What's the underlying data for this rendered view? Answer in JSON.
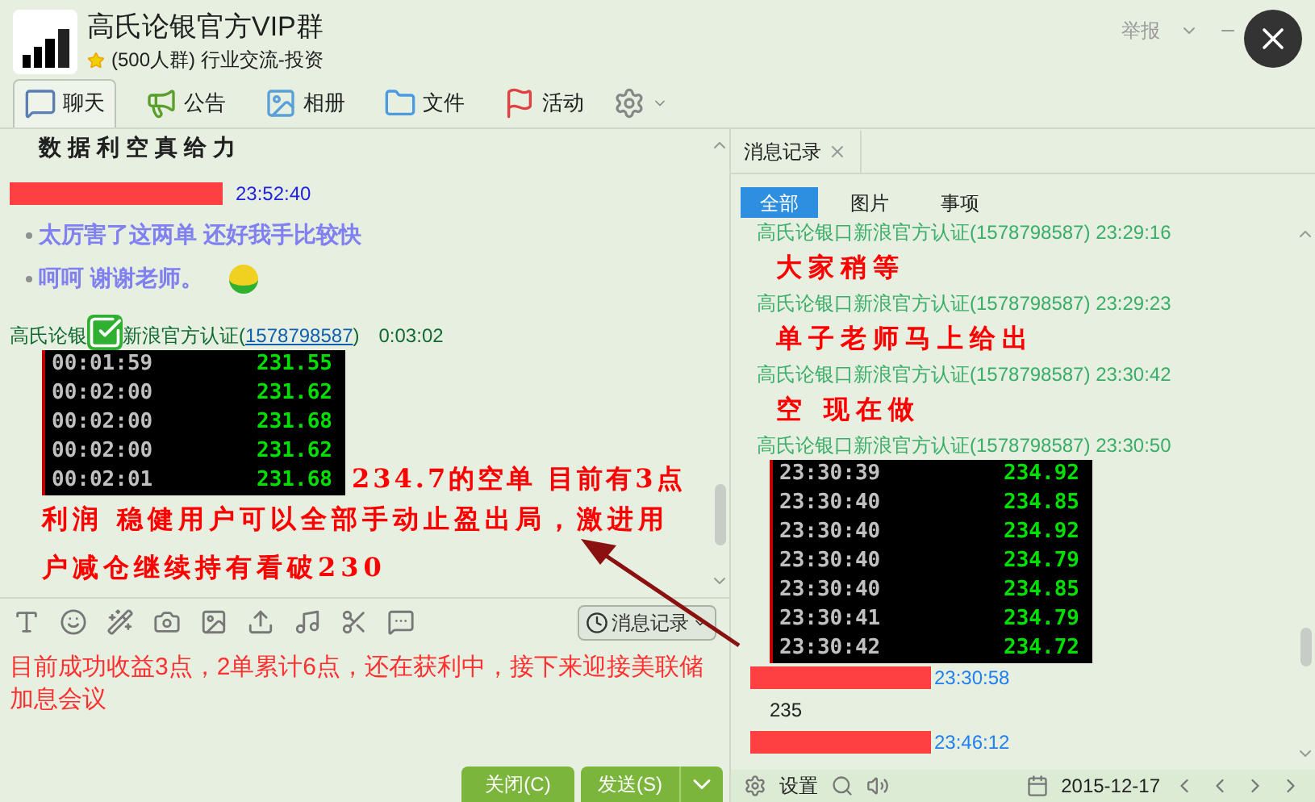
{
  "window": {
    "title": "高氏论银官方VIP群",
    "subtitle": "(500人群) 行业交流-投资",
    "report": "举报"
  },
  "nav_tabs": [
    {
      "label": "聊天",
      "selected": true
    },
    {
      "label": "公告",
      "selected": false
    },
    {
      "label": "相册",
      "selected": false
    },
    {
      "label": "文件",
      "selected": false
    },
    {
      "label": "活动",
      "selected": false
    }
  ],
  "chat": {
    "messages": [
      {
        "kind": "heading",
        "text": "数据利空真给力"
      },
      {
        "kind": "stamp",
        "time": "23:52:40"
      },
      {
        "kind": "bullet",
        "text": "太厉害了这两单 还好我手比较快",
        "emoji": false
      },
      {
        "kind": "bullet",
        "text": "呵呵 谢谢老师。",
        "emoji": true
      },
      {
        "kind": "sender",
        "name": "高氏论银",
        "verified": "新浪官方认证(",
        "id": "1578798587",
        "close": ")",
        "time": "0:03:02"
      },
      {
        "kind": "quote",
        "rows": [
          [
            "00:01:59",
            "231.55"
          ],
          [
            "00:02:00",
            "231.62"
          ],
          [
            "00:02:00",
            "231.68"
          ],
          [
            "00:02:00",
            "231.62"
          ],
          [
            "00:02:01",
            "231.68"
          ]
        ],
        "text": "234.7的空单  目前有3点",
        "text2": "利润 稳健用户可以全部手动止盈出局，激进用户减仓继续持有看破230"
      }
    ]
  },
  "history_button": "消息记录",
  "draft": "目前成功收益3点，2单累计6点，还在获利中，接下来迎接美联储加息会议",
  "buttons": {
    "close": "关闭(C)",
    "send": "发送(S)"
  },
  "history": {
    "tab": "消息记录",
    "filters": [
      {
        "label": "全部",
        "selected": true
      },
      {
        "label": "图片",
        "selected": false
      },
      {
        "label": "事项",
        "selected": false
      }
    ],
    "messages": [
      {
        "kind": "sender",
        "text": "高氏论银口新浪官方认证(1578798587) 23:29:16"
      },
      {
        "kind": "body",
        "text": "大家稍等"
      },
      {
        "kind": "sender",
        "text": "高氏论银口新浪官方认证(1578798587) 23:29:23"
      },
      {
        "kind": "body",
        "text": "单子老师马上给出"
      },
      {
        "kind": "sender",
        "text": "高氏论银口新浪官方认证(1578798587) 23:30:42"
      },
      {
        "kind": "body",
        "text": "空  现在做"
      },
      {
        "kind": "sender",
        "text": "高氏论银口新浪官方认证(1578798587) 23:30:50"
      },
      {
        "kind": "quote",
        "rows": [
          [
            "23:30:39",
            "234.92"
          ],
          [
            "23:30:40",
            "234.85"
          ],
          [
            "23:30:40",
            "234.92"
          ],
          [
            "23:30:40",
            "234.79"
          ],
          [
            "23:30:40",
            "234.85"
          ],
          [
            "23:30:41",
            "234.79"
          ],
          [
            "23:30:42",
            "234.72"
          ]
        ]
      },
      {
        "kind": "stamp",
        "text": "23:30:58"
      },
      {
        "kind": "plain",
        "text": "235"
      },
      {
        "kind": "stamp",
        "text": "23:46:12"
      }
    ],
    "settings": "设置",
    "date": "2015-12-17"
  }
}
